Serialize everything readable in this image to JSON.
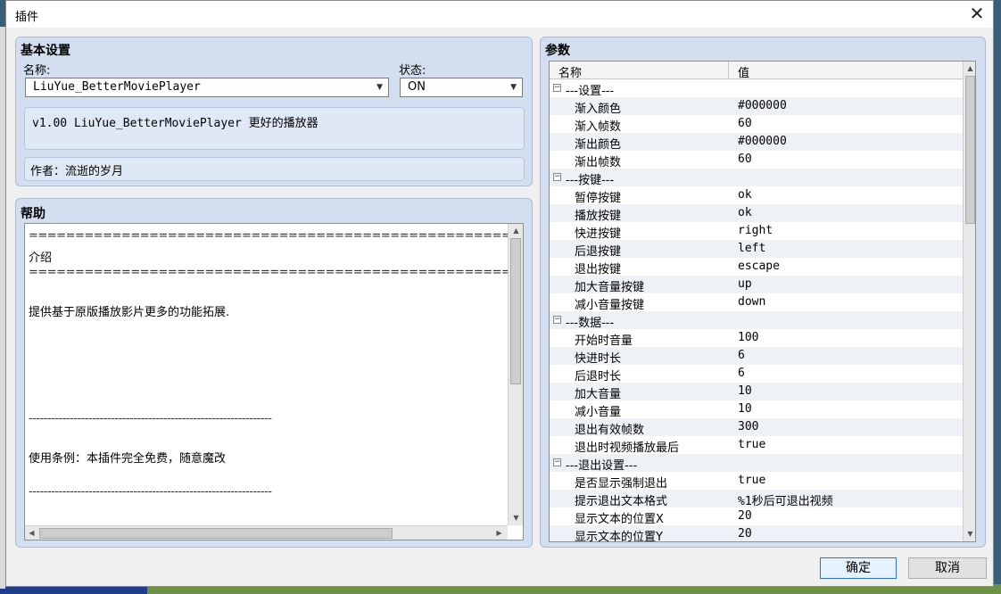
{
  "dialog": {
    "title": "插件",
    "close_label": "✕"
  },
  "basic": {
    "title": "基本设置",
    "name_label": "名称:",
    "name_value": "LiuYue_BetterMoviePlayer",
    "status_label": "状态:",
    "status_value": "ON",
    "description": "v1.00 LiuYue_BetterMoviePlayer 更好的播放器",
    "author": "作者：流逝的岁月"
  },
  "help": {
    "title": "帮助",
    "lines": [
      "===========================================================================",
      "介绍",
      "=========================================================================== *",
      "",
      "提供基于原版播放影片更多的功能拓展.",
      "",
      "",
      "",
      "",
      "",
      "-----------------------------------------------------------------",
      "",
      "使用条例：本插件完全免费，随意魔改",
      "",
      "-----------------------------------------------------------------"
    ]
  },
  "params": {
    "title": "参数",
    "col_name": "名称",
    "col_value": "值",
    "rows": [
      {
        "group": true,
        "name": "---设置---",
        "value": ""
      },
      {
        "group": false,
        "name": "渐入颜色",
        "value": "#000000"
      },
      {
        "group": false,
        "name": "渐入帧数",
        "value": "60"
      },
      {
        "group": false,
        "name": "渐出颜色",
        "value": "#000000"
      },
      {
        "group": false,
        "name": "渐出帧数",
        "value": "60"
      },
      {
        "group": true,
        "name": "---按键---",
        "value": ""
      },
      {
        "group": false,
        "name": "暂停按键",
        "value": "ok"
      },
      {
        "group": false,
        "name": "播放按键",
        "value": "ok"
      },
      {
        "group": false,
        "name": "快进按键",
        "value": "right"
      },
      {
        "group": false,
        "name": "后退按键",
        "value": "left"
      },
      {
        "group": false,
        "name": "退出按键",
        "value": "escape"
      },
      {
        "group": false,
        "name": "加大音量按键",
        "value": "up"
      },
      {
        "group": false,
        "name": "减小音量按键",
        "value": "down"
      },
      {
        "group": true,
        "name": "---数据---",
        "value": ""
      },
      {
        "group": false,
        "name": "开始时音量",
        "value": "100"
      },
      {
        "group": false,
        "name": "快进时长",
        "value": "6"
      },
      {
        "group": false,
        "name": "后退时长",
        "value": "6"
      },
      {
        "group": false,
        "name": "加大音量",
        "value": "10"
      },
      {
        "group": false,
        "name": "减小音量",
        "value": "10"
      },
      {
        "group": false,
        "name": "退出有效帧数",
        "value": "300"
      },
      {
        "group": false,
        "name": "退出时视频播放最后",
        "value": "true"
      },
      {
        "group": true,
        "name": "---退出设置---",
        "value": ""
      },
      {
        "group": false,
        "name": "是否显示强制退出",
        "value": "true"
      },
      {
        "group": false,
        "name": "提示退出文本格式",
        "value": "%1秒后可退出视频"
      },
      {
        "group": false,
        "name": "显示文本的位置X",
        "value": "20"
      },
      {
        "group": false,
        "name": "显示文本的位置Y",
        "value": "20"
      }
    ]
  },
  "buttons": {
    "ok": "确定",
    "cancel": "取消"
  },
  "icons": {
    "expand": "collapse-minus-icon",
    "dropdown": "chevron-down-icon"
  }
}
